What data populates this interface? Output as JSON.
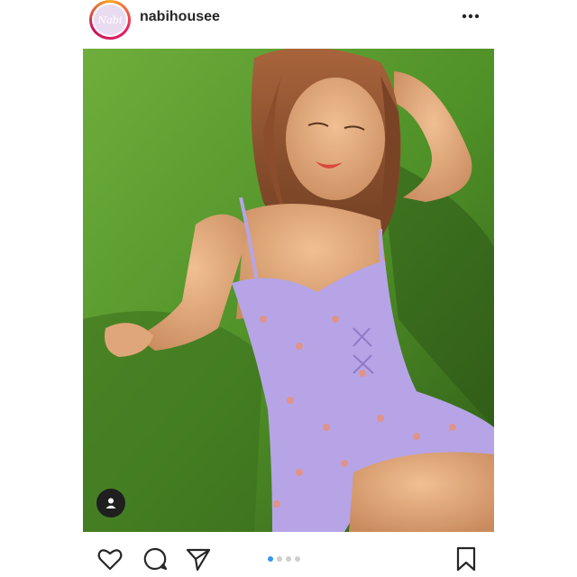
{
  "post": {
    "username": "nabihousee",
    "avatar_text": "Nabi",
    "photo_description_icon": "user-tag-icon",
    "carousel": {
      "count": 4,
      "active_index": 0
    }
  },
  "icons": {
    "more": "more-options-icon",
    "like": "heart-icon",
    "comment": "comment-icon",
    "share": "paper-plane-icon",
    "save": "bookmark-icon"
  },
  "colors": {
    "active_dot": "#3897f0",
    "inactive_dot": "#cfcfcf",
    "dress": "#b7a4e6"
  }
}
